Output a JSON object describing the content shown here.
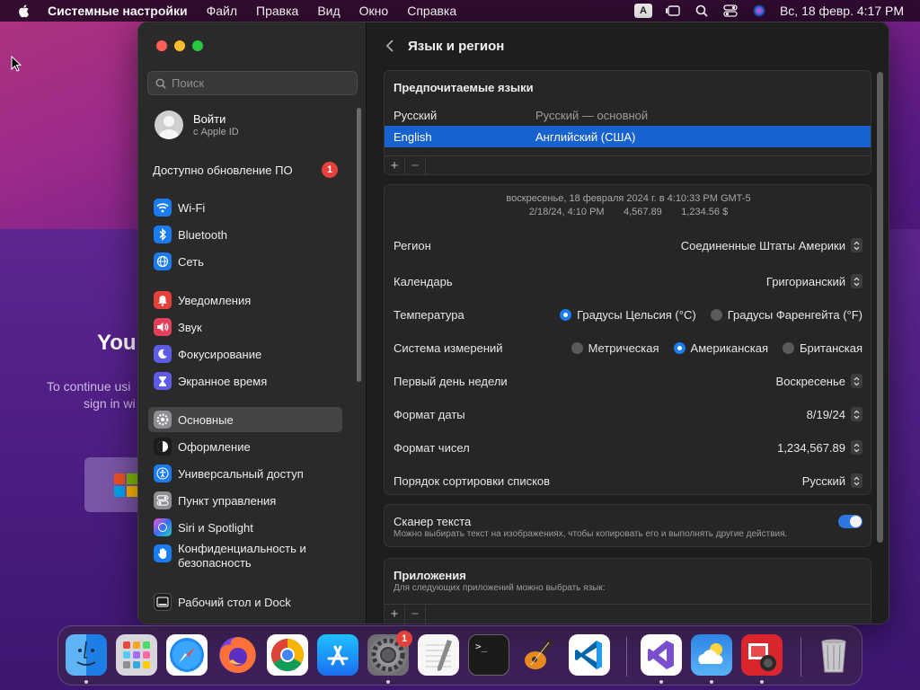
{
  "menubar": {
    "app_name": "Системные настройки",
    "items": [
      "Файл",
      "Правка",
      "Вид",
      "Окно",
      "Справка"
    ],
    "input_source": "A",
    "clock": "Вс, 18 февр.  4:17 PM"
  },
  "background": {
    "heading": "You",
    "subtitle_line1": "To continue usi",
    "subtitle_line2": "sign in wi"
  },
  "sidebar": {
    "search_placeholder": "Поиск",
    "account": {
      "title": "Войти",
      "subtitle": "с Apple ID"
    },
    "update": {
      "label": "Доступно обновление ПО",
      "badge": "1"
    },
    "items": [
      {
        "label": "Wi-Fi",
        "icon": "wifi-icon",
        "color": "#1a7bf2"
      },
      {
        "label": "Bluetooth",
        "icon": "bluetooth-icon",
        "color": "#1a7bf2"
      },
      {
        "label": "Сеть",
        "icon": "globe-icon",
        "color": "#1a7bf2"
      },
      {
        "label": "Уведомления",
        "icon": "bell-icon",
        "color": "#e5403a"
      },
      {
        "label": "Звук",
        "icon": "speaker-icon",
        "color": "#e5405a"
      },
      {
        "label": "Фокусирование",
        "icon": "moon-icon",
        "color": "#5e5ce6"
      },
      {
        "label": "Экранное время",
        "icon": "hourglass-icon",
        "color": "#5e5ce6"
      },
      {
        "label": "Основные",
        "icon": "gear-icon",
        "color": "#8e8e93"
      },
      {
        "label": "Оформление",
        "icon": "appearance-icon",
        "color": "#1c1c1e"
      },
      {
        "label": "Универсальный доступ",
        "icon": "accessibility-icon",
        "color": "#1a7bf2"
      },
      {
        "label": "Пункт управления",
        "icon": "control-center-icon",
        "color": "#8e8e93"
      },
      {
        "label": "Siri и Spotlight",
        "icon": "siri-icon",
        "color": "#8a3ad6"
      },
      {
        "label": "Конфиденциальность и безопасность",
        "label_line1": "Конфиденциальность и",
        "label_line2": "безопасность",
        "icon": "hand-icon",
        "color": "#1a7bf2"
      },
      {
        "label": "Рабочий стол и Dock",
        "icon": "dock-icon",
        "color": "#1c1c1e"
      }
    ],
    "selected_index": 7
  },
  "pane": {
    "title": "Язык и регион",
    "preferred_languages": {
      "title": "Предпочитаемые языки",
      "rows": [
        {
          "name": "Русский",
          "description": "Русский — основной"
        },
        {
          "name": "English",
          "description": "Английский (США)"
        }
      ],
      "selected_index": 1,
      "add_label": "+",
      "remove_label": "−"
    },
    "preview": {
      "line1": "воскресенье, 18 февраля 2024 г. в 4:10:33 PM GMT-5",
      "line2": "2/18/24, 4:10 PM       4,567.89       1,234.56 $"
    },
    "settings": {
      "region": {
        "label": "Регион",
        "value": "Соединенные Штаты Америки"
      },
      "calendar": {
        "label": "Календарь",
        "value": "Григорианский"
      },
      "temperature": {
        "label": "Температура",
        "options": [
          "Градусы Цельсия (°C)",
          "Градусы Фаренгейта (°F)"
        ],
        "selected": 0
      },
      "measurement": {
        "label": "Система измерений",
        "options": [
          "Метрическая",
          "Американская",
          "Британская"
        ],
        "selected": 1
      },
      "first_day": {
        "label": "Первый день недели",
        "value": "Воскресенье"
      },
      "date_format": {
        "label": "Формат даты",
        "value": "8/19/24"
      },
      "number_format": {
        "label": "Формат чисел",
        "value": "1,234,567.89"
      },
      "list_sort": {
        "label": "Порядок сортировки списков",
        "value": "Русский"
      }
    },
    "live_text": {
      "title": "Сканер текста",
      "description": "Можно выбирать текст на изображениях, чтобы копировать его и выполнять другие действия.",
      "enabled": true
    },
    "applications": {
      "title": "Приложения",
      "description": "Для следующих приложений можно выбрать язык:",
      "add_label": "+",
      "remove_label": "−"
    }
  },
  "dock": {
    "apps": [
      {
        "name": "Finder",
        "icon": "finder-icon",
        "running": true
      },
      {
        "name": "Launchpad",
        "icon": "launchpad-icon",
        "running": false
      },
      {
        "name": "Safari",
        "icon": "safari-icon",
        "running": false
      },
      {
        "name": "Firefox",
        "icon": "firefox-icon",
        "running": false
      },
      {
        "name": "Chrome",
        "icon": "chrome-icon",
        "running": false
      },
      {
        "name": "App Store",
        "icon": "app-store-icon",
        "running": false
      },
      {
        "name": "System Settings",
        "icon": "system-settings-icon",
        "running": true,
        "badge": "1"
      },
      {
        "name": "TextEdit",
        "icon": "textedit-icon",
        "running": false
      },
      {
        "name": "Terminal",
        "icon": "terminal-icon",
        "running": false
      },
      {
        "name": "GarageBand",
        "icon": "garageband-icon",
        "running": false
      },
      {
        "name": "VS Code",
        "icon": "vscode-icon",
        "running": false
      },
      {
        "name": "Visual Studio",
        "icon": "visual-studio-icon",
        "running": true
      },
      {
        "name": "Weather",
        "icon": "weather-icon",
        "running": true
      },
      {
        "name": "Photo Booth",
        "icon": "photo-booth-icon",
        "running": true
      },
      {
        "name": "Trash",
        "icon": "trash-icon",
        "running": false
      }
    ],
    "terminal_prompt": ">_"
  }
}
